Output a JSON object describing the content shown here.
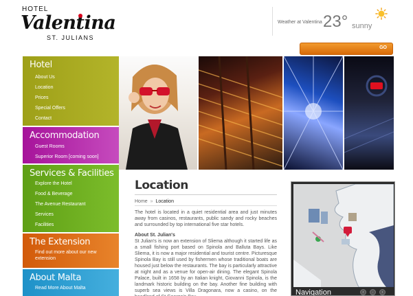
{
  "header": {
    "logo": {
      "hotel": "HOTEL",
      "brand": "Valentina",
      "place": "ST. JULIANS"
    },
    "weather": {
      "label": "Weather at Valentina",
      "temperature": "23°",
      "condition": "sunny",
      "icon": "sun-icon"
    },
    "search": {
      "value": "",
      "go_label": "GO"
    }
  },
  "nav": {
    "hotel": {
      "title": "Hotel",
      "items": [
        "About Us",
        "Location",
        "Prices",
        "Special Offers",
        "Contact"
      ]
    },
    "accommodation": {
      "title": "Accommodation",
      "items": [
        "Guest Rooms",
        "Superior Room [coming soon]"
      ]
    },
    "services": {
      "title": "Services & Facilities",
      "items": [
        "Explore the Hotel",
        "Food & Beverage",
        "The Avenue Restaurant",
        "Services",
        "Facilities"
      ]
    },
    "extension": {
      "title": "The Extension",
      "items": [
        "Find out more about our new extension"
      ]
    },
    "malta": {
      "title": "About Malta",
      "items": [
        "Read More About Malta"
      ]
    }
  },
  "main": {
    "title": "Location",
    "breadcrumb": {
      "home": "Home",
      "separator": "»",
      "current": "Location"
    },
    "intro": "The hotel is located in a quiet residential area and just minutes away from casinos, restaurants, public sandy and rocky beaches and surrounded by top international five star hotels.",
    "about_title": "About St. Julian's",
    "about_body": "St Julian's is now an extension of Sliema although it started life as a small fishing port based on Spinola and Balluta Bays. Like Sliema, it is now a major residential and tourist centre. Picturesque Spinola Bay is still used by fishermen whose traditional boats are housed just below the restaurants. The bay is particularly attractive at night and as a venue for open-air dining. The elegant Spinola Palace, built in 1658 by an Italian knight, Giovanni Spinola, is the landmark historic building on the bay. Another fine building with superb sea views is Villa Dragonara, now a casino, on the headland of St George's Bay."
  },
  "map": {
    "label": "Navigation"
  },
  "colors": {
    "hotel": "#9ea018",
    "accommodation": "#a6139a",
    "services": "#5f9f15",
    "extension": "#d25a0a",
    "malta": "#1e91c8",
    "search_bar": "#e8801a"
  }
}
